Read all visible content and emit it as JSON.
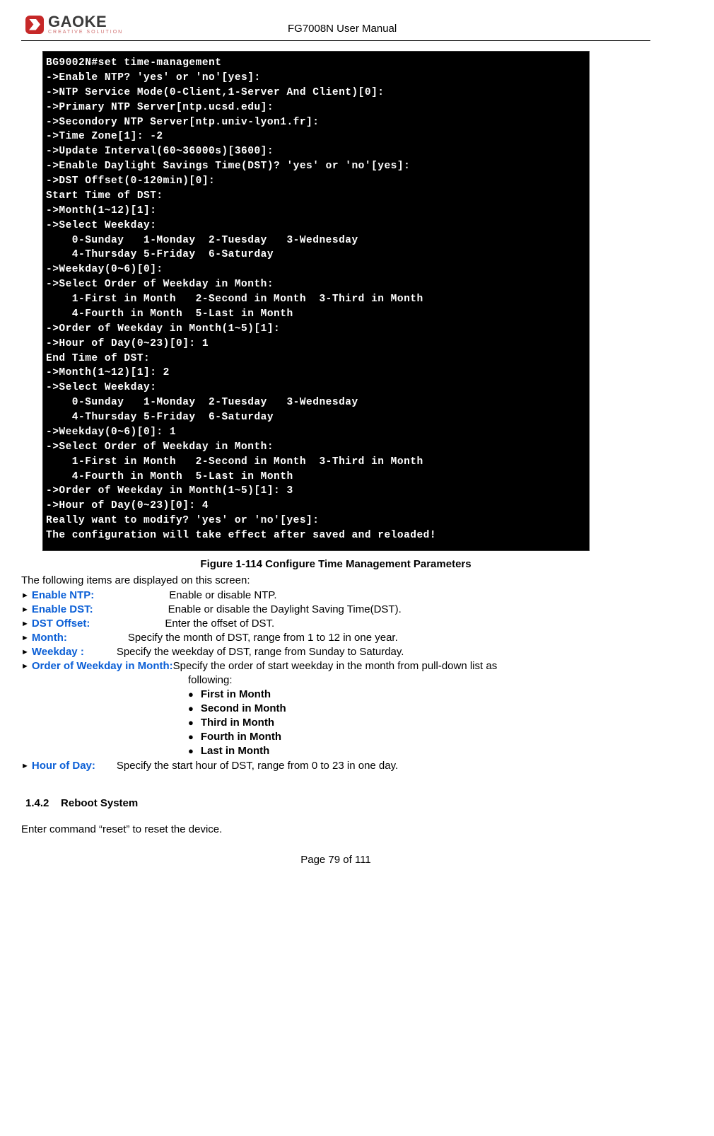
{
  "header": {
    "logo_name": "GAOKE",
    "logo_tag": "CREATIVE SOLUTION",
    "doc_title": "FG7008N User Manual"
  },
  "terminal_text": "BG9002N#set time-management\n->Enable NTP? 'yes' or 'no'[yes]:\n->NTP Service Mode(0-Client,1-Server And Client)[0]:\n->Primary NTP Server[ntp.ucsd.edu]:\n->Secondory NTP Server[ntp.univ-lyon1.fr]:\n->Time Zone[1]: -2\n->Update Interval(60~36000s)[3600]:\n->Enable Daylight Savings Time(DST)? 'yes' or 'no'[yes]:\n->DST Offset(0-120min)[0]:\nStart Time of DST:\n->Month(1~12)[1]:\n->Select Weekday:\n    0-Sunday   1-Monday  2-Tuesday   3-Wednesday\n    4-Thursday 5-Friday  6-Saturday\n->Weekday(0~6)[0]:\n->Select Order of Weekday in Month:\n    1-First in Month   2-Second in Month  3-Third in Month\n    4-Fourth in Month  5-Last in Month\n->Order of Weekday in Month(1~5)[1]:\n->Hour of Day(0~23)[0]: 1\nEnd Time of DST:\n->Month(1~12)[1]: 2\n->Select Weekday:\n    0-Sunday   1-Monday  2-Tuesday   3-Wednesday\n    4-Thursday 5-Friday  6-Saturday\n->Weekday(0~6)[0]: 1\n->Select Order of Weekday in Month:\n    1-First in Month   2-Second in Month  3-Third in Month\n    4-Fourth in Month  5-Last in Month\n->Order of Weekday in Month(1~5)[1]: 3\n->Hour of Day(0~23)[0]: 4\nReally want to modify? 'yes' or 'no'[yes]:\nThe configuration will take effect after saved and reloaded!",
  "figure_caption": "Figure 1-114  Configure Time Management Parameters",
  "intro": "The following items are displayed on this screen:",
  "params": {
    "enable_ntp": {
      "label": "Enable NTP:",
      "desc": "Enable or disable NTP."
    },
    "enable_dst": {
      "label": "Enable DST:",
      "desc": "Enable or disable the Daylight Saving Time(DST)."
    },
    "dst_offset": {
      "label": "DST Offset:",
      "desc": "Enter the offset of DST."
    },
    "month": {
      "label": "Month:",
      "desc": "Specify the month of DST, range from 1 to 12 in one year."
    },
    "weekday": {
      "label": "Weekday :",
      "desc": "Specify the weekday of DST, range from Sunday to Saturday."
    },
    "order": {
      "label": "Order of Weekday in Month:",
      "desc": " Specify the order of start weekday in the month from pull-down list as"
    },
    "hour": {
      "label": "Hour of Day:",
      "desc": "Specify the start hour of DST, range from 0 to 23 in one day."
    }
  },
  "following_word": "following:",
  "bullets": {
    "b1": "First in Month",
    "b2": "Second in Month",
    "b3": "Third in Month",
    "b4": "Fourth in Month",
    "b5": "Last in Month"
  },
  "section": {
    "number": "1.4.2",
    "title": "Reboot System"
  },
  "reset_line": "Enter command “reset” to reset the device.",
  "footer": "Page 79 of 111"
}
